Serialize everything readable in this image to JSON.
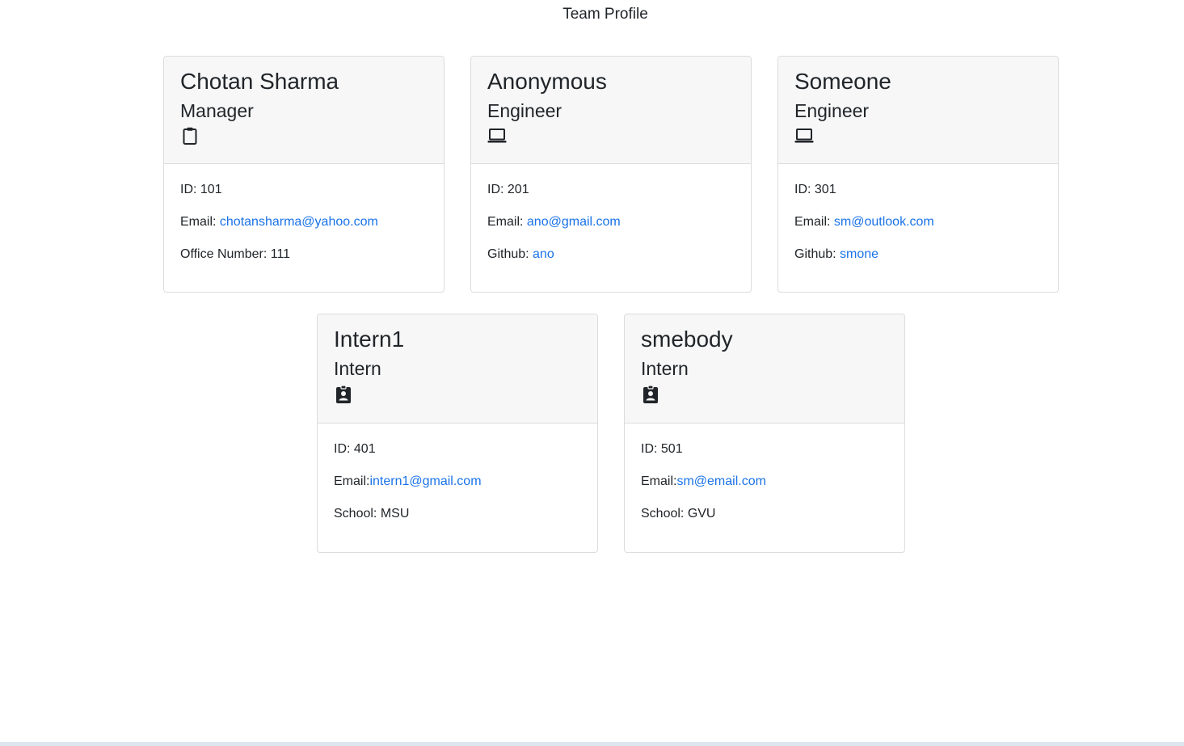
{
  "page": {
    "title": "Team Profile"
  },
  "cards": [
    {
      "name": "Chotan Sharma",
      "role": "Manager",
      "icon": "clipboard-icon",
      "id_label": "ID: 101",
      "email_label": "Email: ",
      "email": "chotansharma@yahoo.com",
      "extra_label": "Office Number: 111",
      "extra_link": ""
    },
    {
      "name": "Anonymous",
      "role": "Engineer",
      "icon": "laptop-icon",
      "id_label": "ID: 201",
      "email_label": "Email: ",
      "email": "ano@gmail.com",
      "extra_label": "Github: ",
      "extra_link": "ano"
    },
    {
      "name": "Someone",
      "role": "Engineer",
      "icon": "laptop-icon",
      "id_label": "ID: 301",
      "email_label": "Email: ",
      "email": "sm@outlook.com",
      "extra_label": "Github: ",
      "extra_link": "smone"
    },
    {
      "name": "Intern1",
      "role": "Intern",
      "icon": "id-badge-icon",
      "id_label": "ID: 401",
      "email_label": "Email:",
      "email": "intern1@gmail.com",
      "extra_label": "School: MSU",
      "extra_link": ""
    },
    {
      "name": "smebody",
      "role": "Intern",
      "icon": "id-badge-icon",
      "id_label": "ID: 501",
      "email_label": "Email:",
      "email": "sm@email.com",
      "extra_label": "School: GVU",
      "extra_link": ""
    }
  ],
  "colors": {
    "link": "#1a73e8",
    "header_bg": "#f7f7f7",
    "border": "#dcdcdc",
    "text": "#212529"
  }
}
